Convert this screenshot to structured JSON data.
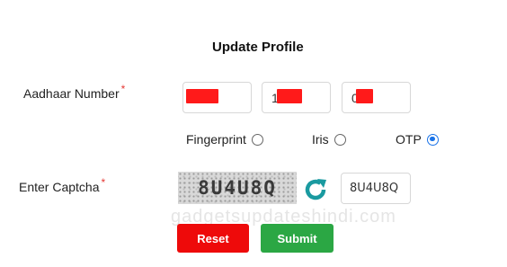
{
  "form": {
    "title": "Update Profile"
  },
  "aadhaar": {
    "label": "Aadhaar Number",
    "required_mark": "*",
    "segments": [
      "",
      "1",
      "0 2"
    ]
  },
  "auth_options": {
    "fingerprint": "Fingerprint",
    "iris": "Iris",
    "otp": "OTP",
    "selected": "OTP"
  },
  "captcha": {
    "label": "Enter Captcha",
    "required_mark": "*",
    "image_text": "8U4U8Q",
    "input_value": "8U4U8Q"
  },
  "watermark": "gadgetsupdateshindi.com",
  "buttons": {
    "reset": "Reset",
    "submit": "Submit"
  },
  "colors": {
    "reset": "#ee0a0a",
    "submit": "#2ba744",
    "radio_selected": "#1a73e8",
    "required": "#e53935",
    "refresh_icon": "#1a9aa0"
  }
}
